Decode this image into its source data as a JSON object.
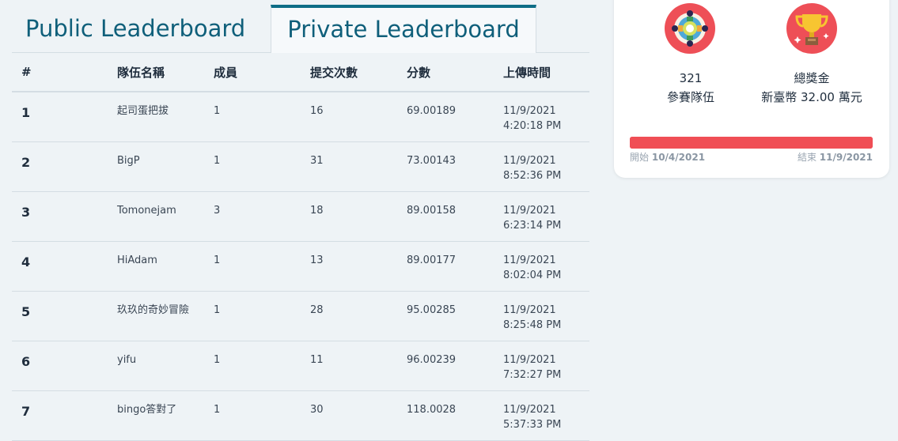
{
  "tabs": [
    {
      "label": "Public Leaderboard",
      "active": false
    },
    {
      "label": "Private Leaderboard",
      "active": true
    }
  ],
  "table": {
    "headers": [
      "#",
      "隊伍名稱",
      "成員",
      "提交次數",
      "分數",
      "上傳時間"
    ],
    "rows": [
      {
        "rank": "1",
        "team": "起司蛋把拔",
        "members": "1",
        "submissions": "16",
        "score": "69.00189",
        "date": "11/9/2021",
        "time": "4:20:18 PM"
      },
      {
        "rank": "2",
        "team": "BigP",
        "members": "1",
        "submissions": "31",
        "score": "73.00143",
        "date": "11/9/2021",
        "time": "8:52:36 PM"
      },
      {
        "rank": "3",
        "team": "Tomonejam",
        "members": "3",
        "submissions": "18",
        "score": "89.00158",
        "date": "11/9/2021",
        "time": "6:23:14 PM"
      },
      {
        "rank": "4",
        "team": "HiAdam",
        "members": "1",
        "submissions": "13",
        "score": "89.00177",
        "date": "11/9/2021",
        "time": "8:02:04 PM"
      },
      {
        "rank": "5",
        "team": "玖玖的奇妙冒險",
        "members": "1",
        "submissions": "28",
        "score": "95.00285",
        "date": "11/9/2021",
        "time": "8:25:48 PM"
      },
      {
        "rank": "6",
        "team": "yifu",
        "members": "1",
        "submissions": "11",
        "score": "96.00239",
        "date": "11/9/2021",
        "time": "7:32:27 PM"
      },
      {
        "rank": "7",
        "team": "bingo答對了",
        "members": "1",
        "submissions": "30",
        "score": "118.0028",
        "date": "11/9/2021",
        "time": "5:37:33 PM"
      }
    ]
  },
  "summary": {
    "teams_count": "321",
    "teams_label": "參賽隊伍",
    "prize_label": "總獎金",
    "prize_value": "新臺幣 32.00 萬元",
    "start_label": "開始",
    "start_date": "10/4/2021",
    "end_label": "結束",
    "end_date": "11/9/2021",
    "progress": 1.0,
    "accent_color": "#f04e55",
    "icons": [
      "teams-icon",
      "trophy-icon"
    ]
  }
}
